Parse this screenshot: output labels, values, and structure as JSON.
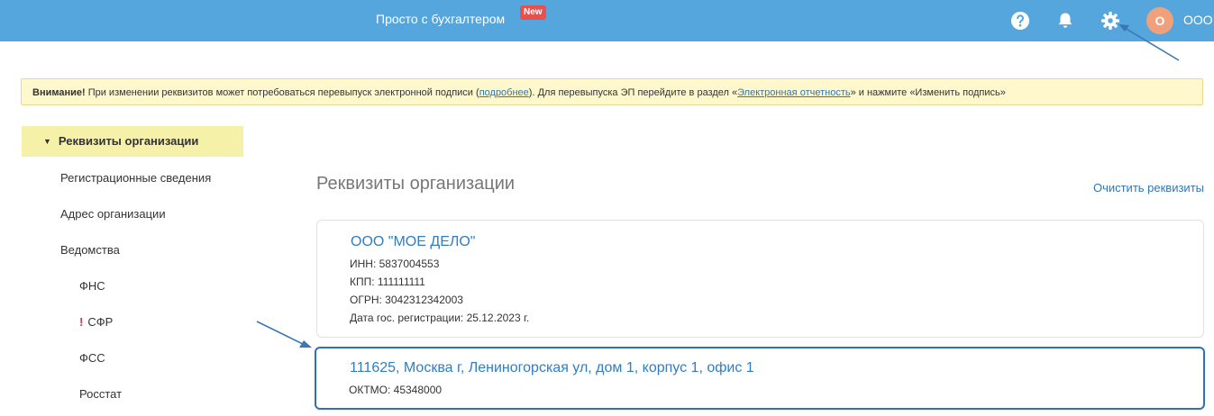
{
  "header": {
    "brand": "Просто с бухгалтером",
    "badge": "New",
    "avatar_letter": "О",
    "org_short": "ООО",
    "icons": [
      "help-icon",
      "bell-icon",
      "gear-icon"
    ]
  },
  "warning": {
    "bold": "Внимание!",
    "text1": " При изменении реквизитов может потребоваться перевыпуск электронной подписи (",
    "link1": "подробнее",
    "text2": "). Для перевыпуска ЭП перейдите в раздел «",
    "link2": "Электронная отчетность",
    "text3": "» и нажмите «Изменить подпись»"
  },
  "sidebar": {
    "active": "Реквизиты организации",
    "items": [
      {
        "label": "Регистрационные сведения"
      },
      {
        "label": "Адрес организации"
      },
      {
        "label": "Ведомства"
      },
      {
        "label": "ФНС"
      },
      {
        "label": "СФР",
        "required_mark": "!"
      },
      {
        "label": "ФСС"
      },
      {
        "label": "Росстат"
      }
    ]
  },
  "main": {
    "title": "Реквизиты организации",
    "clear_link": "Очистить реквизиты",
    "org_card": {
      "name": "ООО  \"МОЕ ДЕЛО\"",
      "inn": "ИНН: 5837004553",
      "kpp": "КПП: 111111111",
      "ogrn": "ОГРН: 3042312342003",
      "reg_date": "Дата гос. регистрации: 25.12.2023 г."
    },
    "address_card": {
      "address": "111625, Москва г, Лениногорская ул, дом 1, корпус 1, офис 1",
      "oktmo": "ОКТМО: 45348000"
    }
  },
  "colors": {
    "header_bg": "#55a6dd",
    "badge_bg": "#e8504d",
    "avatar_bg": "#f0a07b",
    "warning_bg": "#fff8cc",
    "sidebar_active_bg": "#f6f1a8",
    "link": "#2f7dc2",
    "highlight_border": "#2b73b2",
    "annotation_arrow": "#3a78b5"
  }
}
